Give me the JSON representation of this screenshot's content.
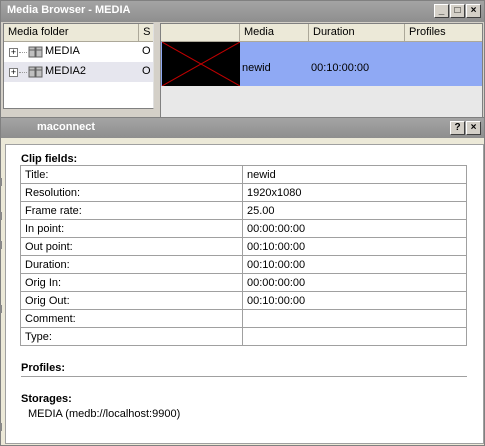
{
  "media_browser": {
    "title": "Media Browser - MEDIA",
    "folder_columns": [
      "Media folder",
      "S"
    ],
    "folders": [
      {
        "label": "MEDIA",
        "status": "O",
        "expander": "+"
      },
      {
        "label": "MEDIA2",
        "status": "O",
        "expander": "+"
      }
    ],
    "media_columns": [
      "Media",
      "Duration",
      "Profiles"
    ],
    "media_items": [
      {
        "id": "newid",
        "duration": "00:10:00:00"
      }
    ]
  },
  "maconnect": {
    "title": "maconnect",
    "clip_fields_heading": "Clip fields:",
    "fields": [
      {
        "label": "Title:",
        "value": "newid"
      },
      {
        "label": "Resolution:",
        "value": "1920x1080"
      },
      {
        "label": "Frame rate:",
        "value": "25.00"
      },
      {
        "label": "In point:",
        "value": "00:00:00:00"
      },
      {
        "label": "Out point:",
        "value": "00:10:00:00"
      },
      {
        "label": "Duration:",
        "value": "00:10:00:00"
      },
      {
        "label": "Orig In:",
        "value": "00:00:00:00"
      },
      {
        "label": "Orig Out:",
        "value": "00:10:00:00"
      },
      {
        "label": "Comment:",
        "value": ""
      },
      {
        "label": "Type:",
        "value": ""
      }
    ],
    "profiles_heading": "Profiles:",
    "storages_heading": "Storages:",
    "storages": [
      "MEDIA (medb://localhost:9900)"
    ]
  },
  "caption_buttons": {
    "minimize": "_",
    "maximize": "□",
    "close": "×",
    "help": "?"
  }
}
